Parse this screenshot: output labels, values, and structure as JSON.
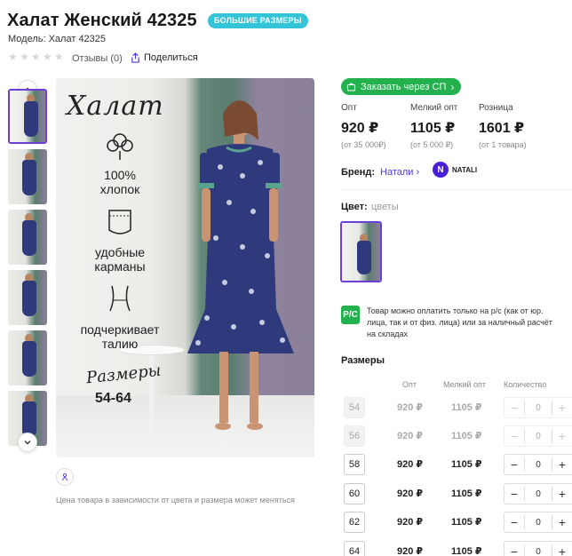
{
  "product": {
    "title": "Халат Женский 42325",
    "badge": "БОЛЬШИЕ РАЗМЕРЫ",
    "model_line": "Модель: Халат 42325",
    "rating_stars": 0,
    "reviews_label": "Отзывы (0)",
    "share_label": "Поделиться"
  },
  "gallery": {
    "thumb_count": 6,
    "selected_index": 0,
    "photo_texts": {
      "title": "Халат",
      "feature1": "100% хлопок",
      "feature2": "удобные карманы",
      "feature3": "подчеркивает талию",
      "sizes_script": "Размеры",
      "sizes_range": "54-64"
    },
    "note": "Цена товара в зависимости от цвета и размера может меняться"
  },
  "order_button": "Заказать через СП",
  "prices": [
    {
      "label": "Опт",
      "value": "920 ₽",
      "sub": "(от 35 000₽)"
    },
    {
      "label": "Мелкий опт",
      "value": "1105 ₽",
      "sub": "(от 5 000 ₽)"
    },
    {
      "label": "Розница",
      "value": "1601 ₽",
      "sub": "(от 1 товара)"
    }
  ],
  "brand": {
    "label": "Бренд:",
    "name": "Натали",
    "logo_letter": "N",
    "logo_text": "NATALI"
  },
  "color": {
    "label": "Цвет:",
    "value": "цветы"
  },
  "payment_note": "Товар можно оплатить только на р/с (как от юр. лица, так и от физ. лица) или за наличный расчёт на складах",
  "payment_icon": "Р/С",
  "sizes": {
    "heading": "Размеры",
    "columns": [
      "Опт",
      "Мелкий опт",
      "Количество"
    ],
    "rows": [
      {
        "size": "54",
        "opt": "920 ₽",
        "small": "1105 ₽",
        "qty": "0",
        "available": false
      },
      {
        "size": "56",
        "opt": "920 ₽",
        "small": "1105 ₽",
        "qty": "0",
        "available": false
      },
      {
        "size": "58",
        "opt": "920 ₽",
        "small": "1105 ₽",
        "qty": "0",
        "available": true
      },
      {
        "size": "60",
        "opt": "920 ₽",
        "small": "1105 ₽",
        "qty": "0",
        "available": true
      },
      {
        "size": "62",
        "opt": "920 ₽",
        "small": "1105 ₽",
        "qty": "0",
        "available": true
      },
      {
        "size": "64",
        "opt": "920 ₽",
        "small": "1105 ₽",
        "qty": "0",
        "available": true
      }
    ]
  },
  "colors": {
    "accent": "#6b3fd8",
    "green": "#23b14d",
    "badge": "#33c4d8",
    "brand_link": "#4a3dd6"
  }
}
